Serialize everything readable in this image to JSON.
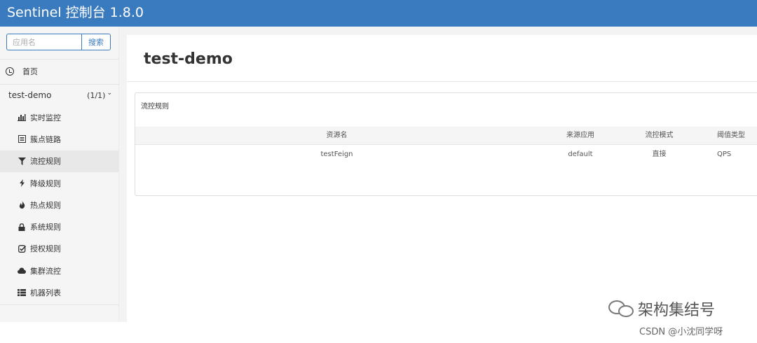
{
  "header": {
    "title": "Sentinel 控制台 1.8.0"
  },
  "sidebar": {
    "search": {
      "placeholder": "应用名",
      "button_label": "搜索"
    },
    "home_label": "首页",
    "app": {
      "name": "test-demo",
      "count": "(1/1)"
    },
    "menu": [
      {
        "label": "实时监控",
        "icon": "bar-chart-icon"
      },
      {
        "label": "簇点链路",
        "icon": "list-alt-icon"
      },
      {
        "label": "流控规则",
        "icon": "filter-icon",
        "active": true
      },
      {
        "label": "降级规则",
        "icon": "flash-icon"
      },
      {
        "label": "热点规则",
        "icon": "fire-icon"
      },
      {
        "label": "系统规则",
        "icon": "lock-icon"
      },
      {
        "label": "授权规则",
        "icon": "check-icon"
      },
      {
        "label": "集群流控",
        "icon": "cloud-icon"
      },
      {
        "label": "机器列表",
        "icon": "th-list-icon"
      }
    ]
  },
  "main": {
    "page_title": "test-demo",
    "panel": {
      "title": "流控规则",
      "columns": [
        "资源名",
        "来源应用",
        "流控模式",
        "阈值类型"
      ],
      "rows": [
        [
          "testFeign",
          "default",
          "直接",
          "QPS"
        ]
      ]
    }
  },
  "watermark": {
    "brand": "架构集结号",
    "credit": "CSDN @小沈同学呀"
  },
  "colors": {
    "header_bg": "#3a7bbf",
    "sidebar_bg": "#f5f5f5",
    "active_item_bg": "#e8e8e8"
  }
}
